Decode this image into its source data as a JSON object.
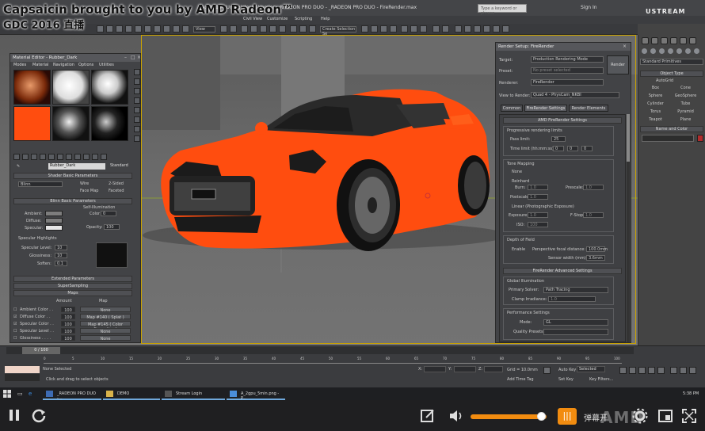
{
  "overlay": {
    "line1": "Capsaicin brought to you by AMD Radeon™",
    "line2": "GDC 2016 直播"
  },
  "app": {
    "title": "Max 2016 - Unregistered Version  _RADEON PRO DUO - _RADEON PRO DUO - FireRender.max",
    "search_placeholder": "Type a keyword or phrase",
    "sign_in": "Sign In",
    "watermark": "USTREAM",
    "menus": [
      "Civil View",
      "Customize",
      "Scripting",
      "Help"
    ],
    "toolbar_dropdown1": "View",
    "toolbar_dropdown2": "Create Selection Se"
  },
  "material_editor": {
    "title": "Material Editor - Rubber_Dark",
    "menus": [
      "Modes",
      "Material",
      "Navigation",
      "Options",
      "Utilities"
    ],
    "material_name": "Rubber_Dark",
    "material_type": "Standard",
    "shader_basic": {
      "header": "Shader Basic Parameters",
      "shader": "Blinn",
      "wire": "Wire",
      "two_sided": "2-Sided",
      "face_map": "Face Map",
      "faceted": "Faceted"
    },
    "blinn_basic": {
      "header": "Blinn Basic Parameters",
      "self_illum": "Self-Illumination",
      "ambient": "Ambient:",
      "diffuse": "Diffuse:",
      "specular": "Specular:",
      "color": "Color",
      "color_val": "0",
      "opacity": "Opacity:",
      "opacity_val": "100"
    },
    "spec_highlights": {
      "header": "Specular Highlights",
      "level_label": "Specular Level:",
      "level": "10",
      "gloss_label": "Glossiness:",
      "gloss": "10",
      "soften_label": "Soften:",
      "soften": "0.1"
    },
    "extended": "Extended Parameters",
    "supersampling": "SuperSampling",
    "maps": {
      "header": "Maps",
      "col_amount": "Amount",
      "col_map": "Map",
      "rows": [
        {
          "name": "Ambient Color . .",
          "amount": "100",
          "map": "None",
          "checked": false
        },
        {
          "name": "Diffuse Color . .",
          "amount": "100",
          "map": "Map #140  ( Splat )",
          "checked": true
        },
        {
          "name": "Specular Color . .",
          "amount": "100",
          "map": "Map #145  ( Color Correction )",
          "checked": true
        },
        {
          "name": "Specular Level . .",
          "amount": "100",
          "map": "None",
          "checked": false
        },
        {
          "name": "Glossiness . . . .",
          "amount": "100",
          "map": "None",
          "checked": false
        }
      ]
    }
  },
  "render_setup": {
    "title": "Render Setup: FireRender",
    "target_label": "Target:",
    "target": "Production Rendering Mode",
    "preset_label": "Preset:",
    "preset": "No preset selected",
    "renderer_label": "Renderer:",
    "renderer": "FireRender",
    "view_label": "View to Render:",
    "view": "Quad 4 - PhysCam_NKBI",
    "render_button": "Render",
    "tabs": [
      "Common",
      "FireRender Settings",
      "Render Elements"
    ],
    "amd_settings": "AMD FireRender Settings",
    "progressive": "Progressive rendering limits",
    "pass_limit_label": "Pass limit:",
    "pass_limit": "25",
    "time_limit_label": "Time limit (hh:mm:ss):",
    "time_h": "0",
    "time_m": "0",
    "time_s": "0",
    "tone_mapping": "Tone Mapping",
    "tm_none": "None",
    "tm_reinhard": "Reinhard",
    "burn_label": "Burn:",
    "burn": "1.0",
    "prescale_label": "Prescale:",
    "prescale": "1.0",
    "postscale_label": "Postscale:",
    "postscale": "1.0",
    "tm_linear": "Linear (Photographic Exposure)",
    "exposure_label": "Exposure:",
    "exposure": "1.0",
    "fstop_label": "F-Stop:",
    "fstop": "1.0",
    "iso_label": "ISO:",
    "iso": "100",
    "dof": "Depth of Field",
    "enable": "Enable",
    "focal_label": "Perspective focal distance:",
    "focal": "100.0mm",
    "sensor_label": "Sensor width (mm):",
    "sensor": "3.6mm",
    "advanced": "FireRender Advanced Settings",
    "global_illum": "Global Illumination",
    "primary_solver_label": "Primary Solver:",
    "primary_solver": "Path Tracing",
    "clamp": "Clamp Irradiance:",
    "clamp_val": "1.0",
    "perf": "Performance Settings",
    "mode_label": "Mode:",
    "mode": "GL",
    "quality_label": "Quality Presets:"
  },
  "command_panel": {
    "dropdown": "Standard Primitives",
    "object_type": "Object Type",
    "autogrid": "AutoGrid",
    "objects": [
      "Box",
      "Cone",
      "Sphere",
      "GeoSphere",
      "Cylinder",
      "Tube",
      "Torus",
      "Pyramid",
      "Teapot",
      "Plane"
    ],
    "name_and_color": "Name and Color"
  },
  "timeline": {
    "frame": "0 / 100",
    "ticks": [
      "0",
      "5",
      "10",
      "15",
      "20",
      "25",
      "30",
      "35",
      "40",
      "45",
      "50",
      "55",
      "60",
      "65",
      "70",
      "75",
      "80",
      "85",
      "90",
      "95",
      "100"
    ],
    "none_selected": "None Selected",
    "hint": "Click and drag to select objects",
    "x_label": "X:",
    "y_label": "Y:",
    "z_label": "Z:",
    "grid": "Grid = 10.0mm",
    "add_time_tag": "Add Time Tag",
    "auto_key": "Auto Key",
    "set_key": "Set Key",
    "selected": "Selected",
    "key_filters": "Key Filters..."
  },
  "taskbar": {
    "items": [
      "_RADEON PRO DUO -...",
      "DEMO",
      "Stream Login",
      "A_2gpu_5min.png - P..."
    ],
    "clock": "5:38 PM"
  },
  "player": {
    "danmu_label": "弹幕开",
    "volume": 0.93,
    "brand_watermark": "AMD"
  },
  "colors": {
    "car": "#ff4d0f",
    "selection": "#caa300",
    "accent": "#f28c10"
  }
}
